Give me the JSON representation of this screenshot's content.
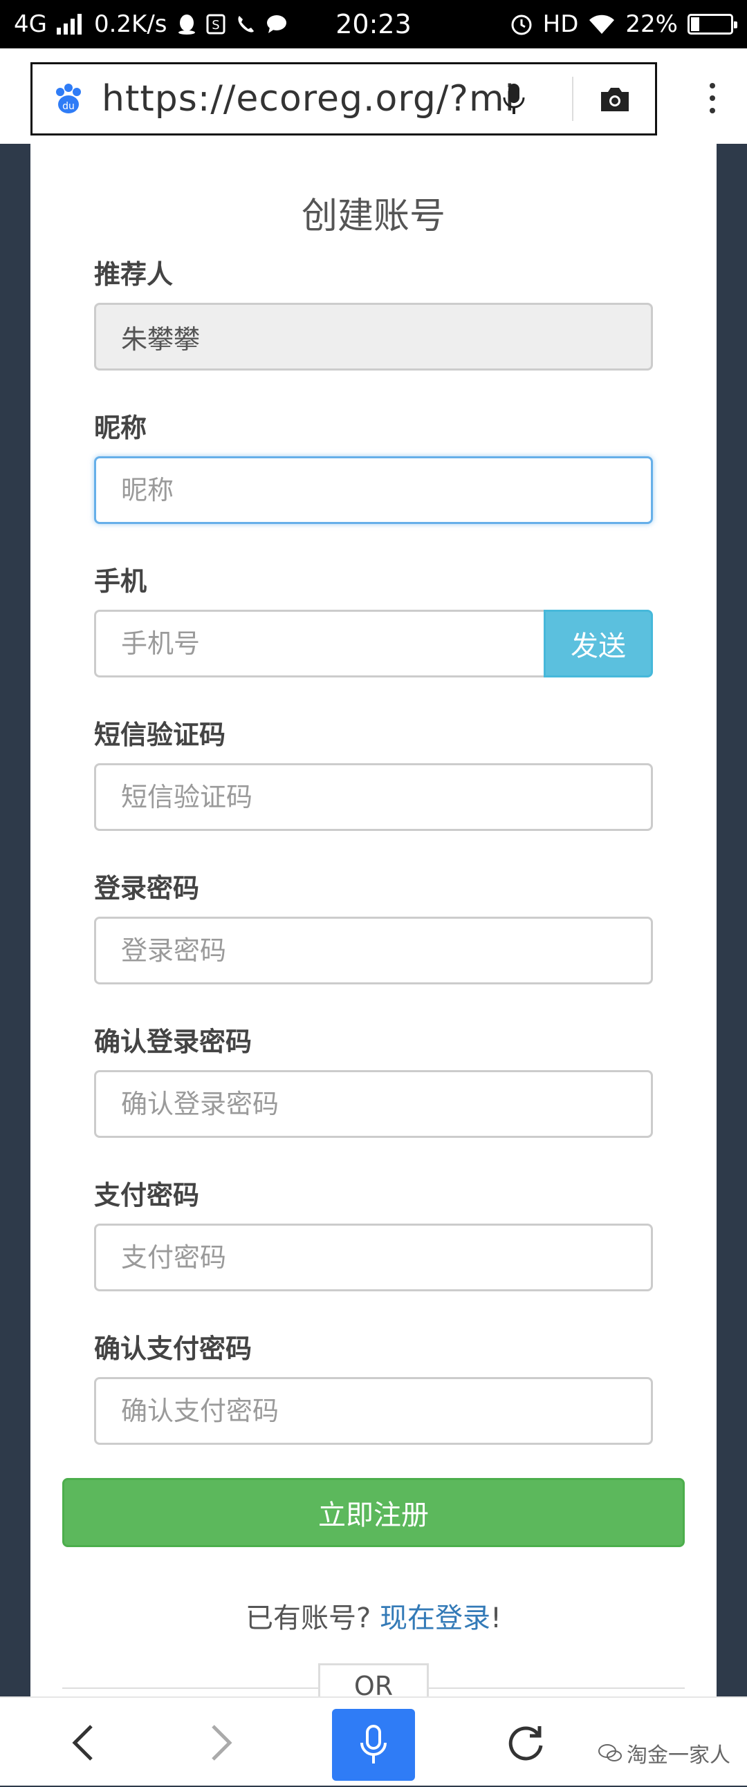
{
  "status_bar": {
    "network": "4G",
    "speed": "0.2K/s",
    "time": "20:23",
    "hd": "HD",
    "battery": "22%",
    "battery_level": 0.22
  },
  "browser": {
    "url": "https://ecoreg.org/?mid"
  },
  "form": {
    "title": "创建账号",
    "referrer": {
      "label": "推荐人",
      "value": "朱攀攀"
    },
    "nickname": {
      "label": "昵称",
      "placeholder": "昵称"
    },
    "phone": {
      "label": "手机",
      "placeholder": "手机号",
      "send_label": "发送"
    },
    "sms_code": {
      "label": "短信验证码",
      "placeholder": "短信验证码"
    },
    "login_password": {
      "label": "登录密码",
      "placeholder": "登录密码"
    },
    "confirm_login_password": {
      "label": "确认登录密码",
      "placeholder": "确认登录密码"
    },
    "pay_password": {
      "label": "支付密码",
      "placeholder": "支付密码"
    },
    "confirm_pay_password": {
      "label": "确认支付密码",
      "placeholder": "确认支付密码"
    },
    "register_label": "立即注册",
    "have_account_text": "已有账号? ",
    "login_link": "现在登录",
    "exclaim": "!",
    "or_label": "OR"
  },
  "watermark": {
    "text": "淘金一家人"
  },
  "colors": {
    "page_background": "#2e3a4a",
    "send_button": "#5bc0de",
    "register_button": "#5cb85c",
    "link": "#337ab7",
    "voice_button": "#2f7cf6"
  }
}
